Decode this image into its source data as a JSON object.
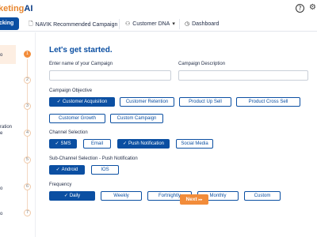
{
  "app": {
    "logo_main": "keting",
    "logo_suffix": "AI"
  },
  "topbar": {
    "help_icon": "?",
    "settings_icon": "⚙"
  },
  "nav": {
    "active_label": "cking",
    "items": [
      {
        "label": "NAVIK Recommended Campaign",
        "icon": "🗋"
      },
      {
        "label": "Customer DNA",
        "icon": "⚇",
        "caret": "▾"
      },
      {
        "label": "Dashboard",
        "icon": "◷"
      }
    ]
  },
  "sidebar": {
    "labels": [
      "o",
      "",
      "",
      "ration",
      "e",
      "",
      "o",
      "",
      "o"
    ],
    "steps": [
      "1",
      "2",
      "3",
      "4",
      "5",
      "6",
      "7"
    ]
  },
  "form": {
    "heading": "Let's get started.",
    "campaign_name_label": "Enter name of your Campaign",
    "campaign_name_value": "",
    "campaign_desc_label": "Campaign Description",
    "campaign_desc_value": "",
    "objective_label": "Campaign Objective",
    "objectives": [
      {
        "label": "Customer Acquisition",
        "selected": true
      },
      {
        "label": "Customer Retention",
        "selected": false
      },
      {
        "label": "Product Up Sell",
        "selected": false
      },
      {
        "label": "Product Cross Sell",
        "selected": false
      },
      {
        "label": "Customer Growth",
        "selected": false
      },
      {
        "label": "Custom Campaign",
        "selected": false
      }
    ],
    "channel_label": "Channel Selection",
    "channels": [
      {
        "label": "SMS",
        "selected": true
      },
      {
        "label": "Email",
        "selected": false
      },
      {
        "label": "Push Notification",
        "selected": true
      },
      {
        "label": "Social Media",
        "selected": false
      }
    ],
    "subchannel_label": "Sub-Channel Selection - Push Notification",
    "subchannels": [
      {
        "label": "Android",
        "selected": true
      },
      {
        "label": "IOS",
        "selected": false
      }
    ],
    "frequency_label": "Frequency",
    "frequencies": [
      {
        "label": "Daily",
        "selected": true
      },
      {
        "label": "Weekly",
        "selected": false
      },
      {
        "label": "Fortnightly",
        "selected": false
      },
      {
        "label": "Monthly",
        "selected": false
      },
      {
        "label": "Custom",
        "selected": false
      }
    ],
    "check_icon": "✓",
    "next_label": "Next",
    "next_icon": "▸▸"
  }
}
